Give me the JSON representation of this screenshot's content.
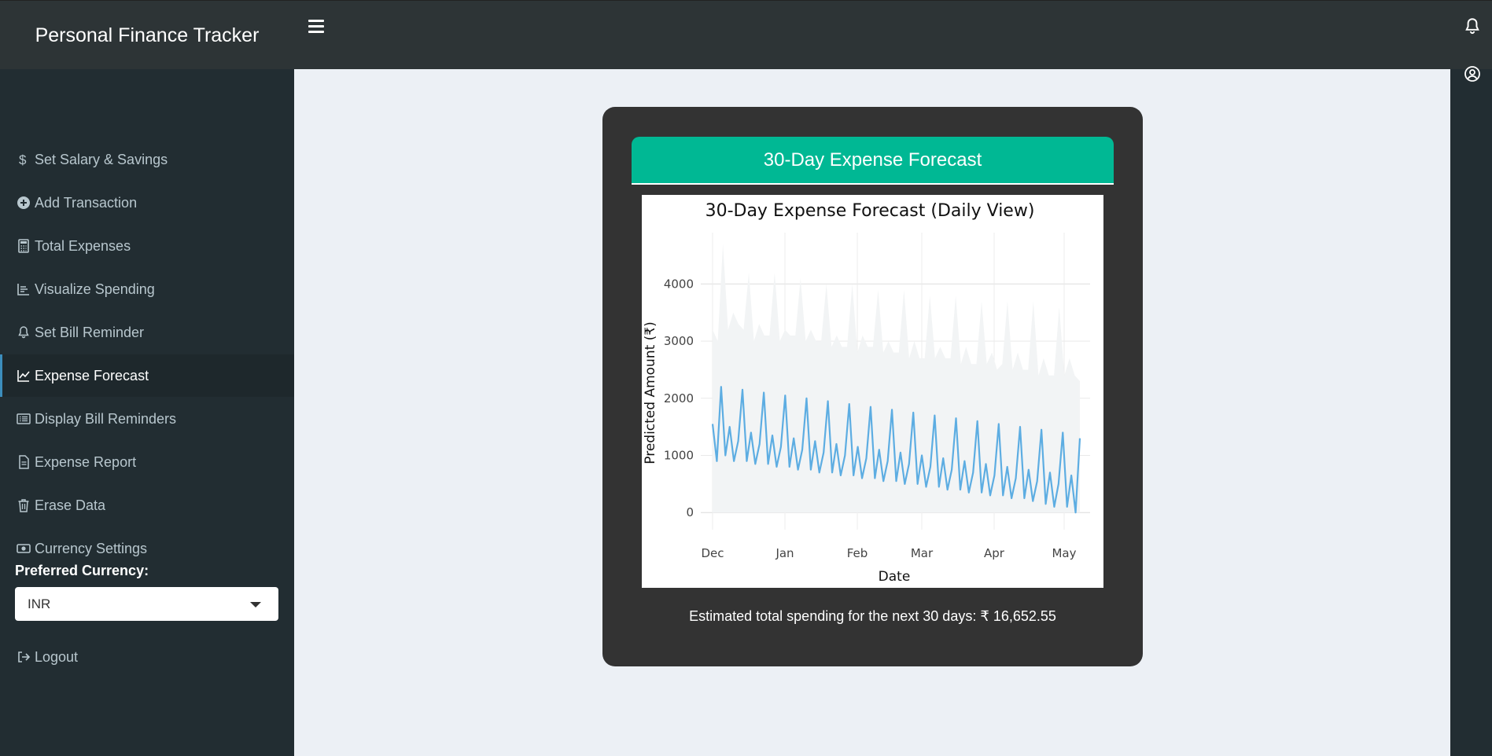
{
  "app": {
    "title": "Personal Finance Tracker"
  },
  "sidebar": {
    "items": [
      {
        "label": "Set Salary & Savings",
        "icon": "dollar-icon"
      },
      {
        "label": "Add Transaction",
        "icon": "plus-circle-icon"
      },
      {
        "label": "Total Expenses",
        "icon": "calculator-icon"
      },
      {
        "label": "Visualize Spending",
        "icon": "bar-chart-icon"
      },
      {
        "label": "Set Bill Reminder",
        "icon": "bell-icon"
      },
      {
        "label": "Expense Forecast",
        "icon": "line-chart-icon",
        "active": true
      },
      {
        "label": "Display Bill Reminders",
        "icon": "list-icon"
      },
      {
        "label": "Expense Report",
        "icon": "file-icon"
      },
      {
        "label": "Erase Data",
        "icon": "trash-icon"
      },
      {
        "label": "Currency Settings",
        "icon": "money-icon"
      }
    ],
    "preferred_currency_label": "Preferred Currency:",
    "preferred_currency_value": "INR",
    "logout_label": "Logout"
  },
  "card": {
    "header": "30-Day Expense Forecast",
    "summary_prefix": "Estimated total spending for the next 30 days:",
    "summary_value": "₹ 16,652.55"
  },
  "colors": {
    "accent": "#00b894",
    "line": "#5dade2",
    "band": "#f2f4f5",
    "topbar": "#2d3436",
    "sidebar": "#222d32"
  },
  "chart_data": {
    "type": "line",
    "title": "30-Day Expense Forecast (Daily View)",
    "xlabel": "Date",
    "ylabel": "Predicted Amount (₹)",
    "x_ticks": [
      "Dec",
      "Jan",
      "Feb",
      "Mar",
      "Apr",
      "May"
    ],
    "y_ticks": [
      0,
      1000,
      2000,
      3000,
      4000
    ],
    "ylim": [
      -300,
      4900
    ],
    "grid": true,
    "series": [
      {
        "kind": "band",
        "description_of_values": "upper bound",
        "values": [
          3200,
          3000,
          4700,
          3200,
          3500,
          3300,
          3200,
          4200,
          3000,
          3300,
          3100,
          3100,
          4200,
          3000,
          3200,
          3100,
          3100,
          4100,
          3000,
          3200,
          3000,
          3000,
          4000,
          2900,
          3100,
          2900,
          2900,
          4000,
          2800,
          3100,
          2900,
          2900,
          3900,
          2800,
          3000,
          2800,
          2800,
          3900,
          2700,
          3000,
          2700,
          2700,
          3800,
          2700,
          2900,
          2700,
          2700,
          3800,
          2600,
          2900,
          2600,
          2600,
          3700,
          2600,
          2800,
          2500,
          2600,
          3700,
          2500,
          2800,
          2500,
          2500,
          3700,
          2400,
          2700,
          2400,
          2400,
          3600,
          2400,
          2700,
          2400,
          2300
        ]
      },
      {
        "kind": "line",
        "values": [
          1550,
          900,
          2200,
          1000,
          1500,
          900,
          1250,
          2150,
          900,
          1400,
          850,
          1200,
          2100,
          850,
          1350,
          800,
          1150,
          2050,
          800,
          1300,
          750,
          1100,
          2000,
          750,
          1250,
          700,
          1050,
          1950,
          700,
          1200,
          650,
          1000,
          1900,
          650,
          1150,
          600,
          950,
          1850,
          600,
          1100,
          550,
          900,
          1800,
          550,
          1050,
          500,
          850,
          1750,
          500,
          1000,
          450,
          800,
          1700,
          450,
          950,
          400,
          750,
          1650,
          400,
          900,
          350,
          700,
          1600,
          350,
          850,
          300,
          650,
          1550,
          300,
          800,
          250,
          600,
          1500,
          250,
          750,
          200,
          550,
          1450,
          150,
          700,
          100,
          500,
          1400,
          100,
          650,
          0,
          1300
        ]
      }
    ]
  }
}
